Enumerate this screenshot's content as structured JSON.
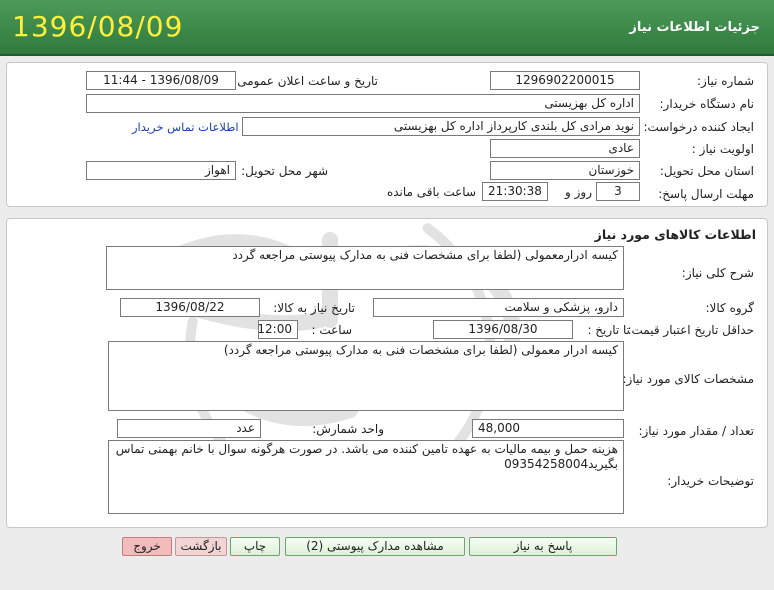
{
  "header": {
    "date": "1396/08/09",
    "title": "جزئیات اطلاعات نیاز"
  },
  "details": {
    "need_number_label": "شماره نیاز:",
    "need_number": "1296902200015",
    "announce_label": "تاریخ و ساعت اعلان عمومی:",
    "announce_value": "1396/08/09 - 11:44",
    "buyer_name_label": "نام دستگاه خریدار:",
    "buyer_name": "اداره کل بهزیستی",
    "creator_label": "ایجاد کننده درخواست:",
    "creator": "نوید مرادی کل بلندی کارپرداز اداره کل بهزیستی",
    "contact_link": "اطلاعات تماس خریدار",
    "priority_label": "اولویت نیاز :",
    "priority": "عادی",
    "province_label": "استان محل تحویل:",
    "province": "خوزستان",
    "city_label": "شهر محل تحویل:",
    "city": "اهواز",
    "deadline_label": "مهلت ارسال پاسخ:",
    "days": "3",
    "days_unit": "روز و",
    "time_left": "21:30:38",
    "time_left_suffix": "ساعت باقی مانده"
  },
  "goods": {
    "section_title": "اطلاعات کالاهای مورد نیاز",
    "summary_label": "شرح کلی نیاز:",
    "summary": "کیسه ادرارمعمولی (لطفا برای مشخصات فنی به مدارک پیوستی مراجعه گردد",
    "group_label": "گروه کالا:",
    "group": "دارو، پزشکی و سلامت",
    "need_date_label": "تاریخ نیاز به کالا:",
    "need_date": "1396/08/22",
    "min_price_label": "حداقل تاریخ اعتبار قیمت:",
    "until_label": "تا تاریخ :",
    "until_date": "1396/08/30",
    "hour_label": "ساعت :",
    "hour": "12:00",
    "specs_label": "مشخصات کالای مورد نیاز:",
    "specs": "کیسه ادرار معمولی (لطفا برای مشخصات فنی به مدارک پیوستی مراجعه گردد)",
    "qty_label": "تعداد / مقدار مورد نیاز:",
    "qty": "48,000",
    "unit_label": "واحد شمارش:",
    "unit": "عدد",
    "notes_label": "توضیحات خریدار:",
    "notes": "هزینه حمل و بیمه مالیات به عهده تامین کننده می باشد. در صورت هرگونه سوال با خانم بهمنی تماس بگیرید09354258004"
  },
  "buttons": {
    "reply": "پاسخ به نیاز",
    "attachments": "مشاهده مدارک پیوستی (2)",
    "print": "چاپ",
    "back": "بازگشت",
    "exit": "خروج"
  }
}
